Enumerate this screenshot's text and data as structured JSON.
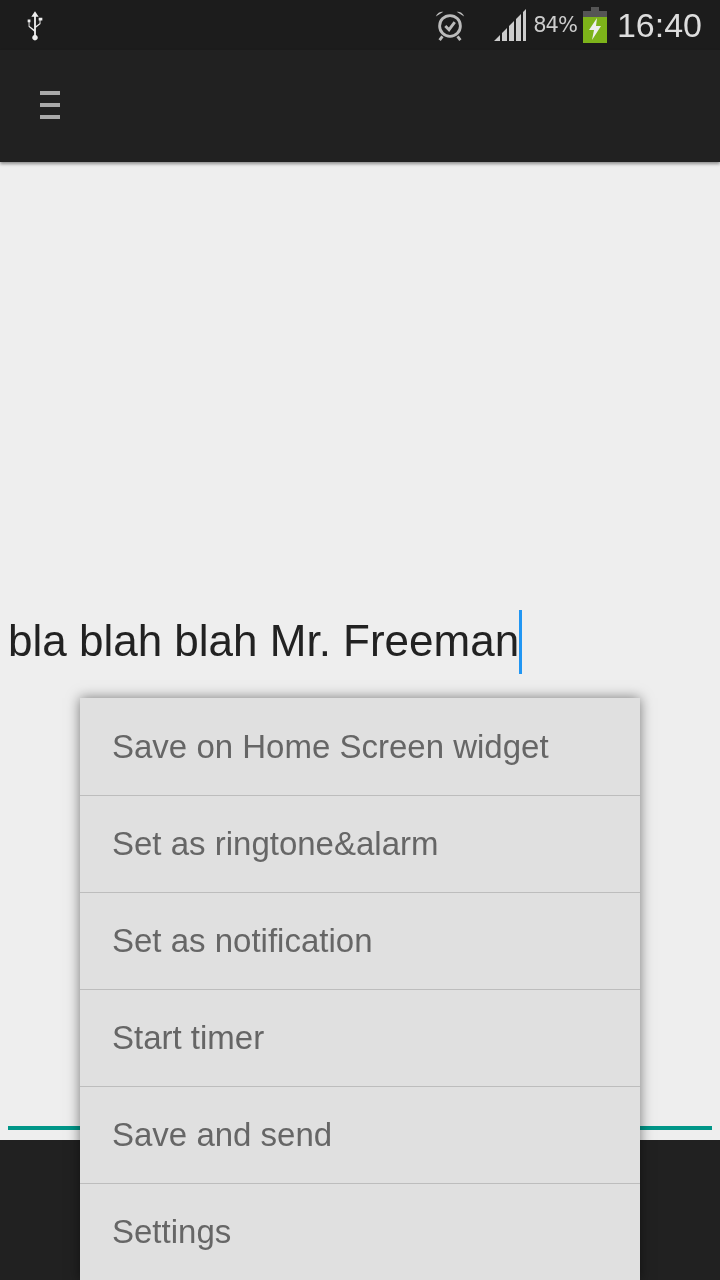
{
  "status_bar": {
    "battery_percent": "84%",
    "time": "16:40",
    "charging": true
  },
  "editor": {
    "value": "bla blah blah Mr. Freeman",
    "focused": true
  },
  "menu": {
    "items": [
      {
        "label": "Save on Home Screen widget"
      },
      {
        "label": "Set as ringtone&alarm"
      },
      {
        "label": "Set as notification"
      },
      {
        "label": "Start timer"
      },
      {
        "label": "Save and send"
      },
      {
        "label": "Settings"
      }
    ]
  }
}
